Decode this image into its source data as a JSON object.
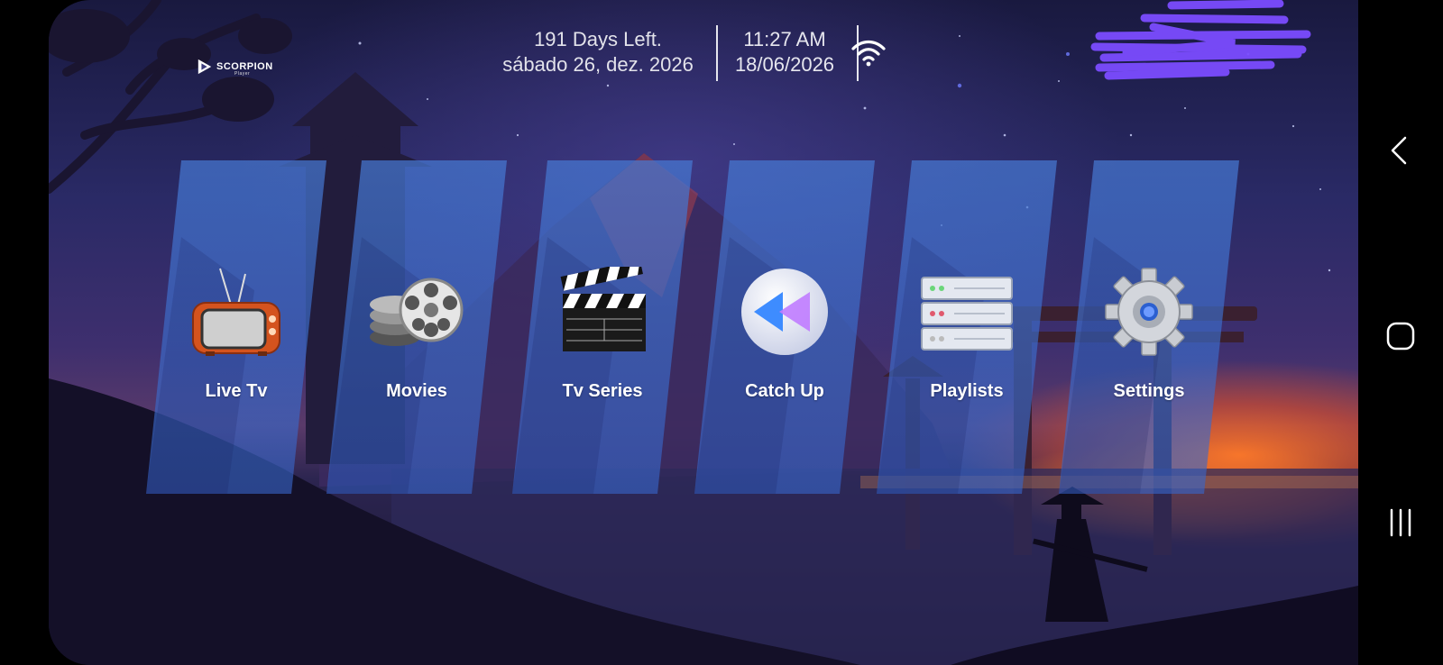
{
  "brand": {
    "logo_text": "SCORPION",
    "logo_sub": "Player"
  },
  "status": {
    "days_left": "191 Days Left.",
    "expiry_date": "sábado 26, dez. 2026",
    "time": "11:27 AM",
    "date": "18/06/2026",
    "wifi_icon": "wifi-icon"
  },
  "menu": [
    {
      "label": "Live Tv",
      "icon": "tv-icon"
    },
    {
      "label": "Movies",
      "icon": "film-reels-icon"
    },
    {
      "label": "Tv Series",
      "icon": "clapperboard-icon"
    },
    {
      "label": "Catch Up",
      "icon": "rewind-icon"
    },
    {
      "label": "Playlists",
      "icon": "server-icon"
    },
    {
      "label": "Settings",
      "icon": "gear-icon"
    }
  ],
  "navigation": {
    "back": "back-icon",
    "home": "home-icon",
    "recents": "recents-icon"
  },
  "colors": {
    "tile": "#4a7fd0",
    "redaction": "#7b4cff",
    "sunset": "#ff7a2a"
  }
}
